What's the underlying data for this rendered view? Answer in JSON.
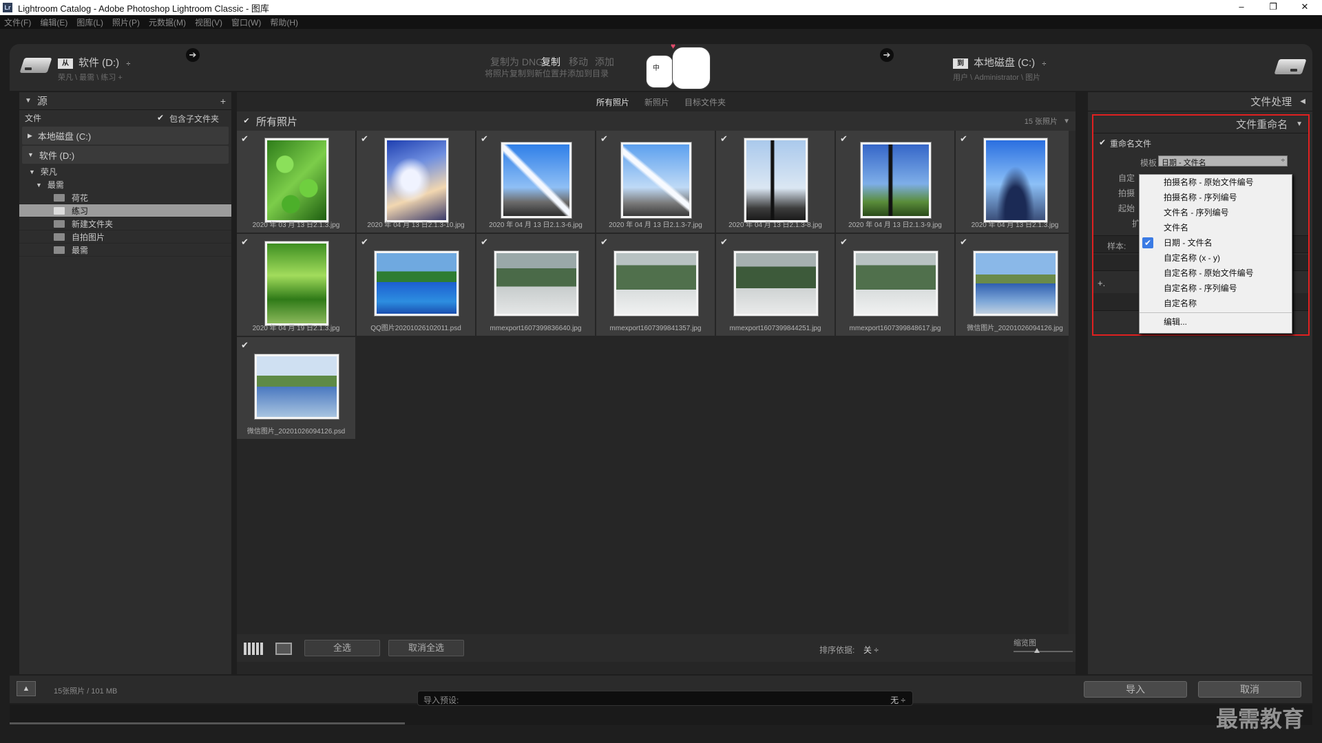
{
  "window": {
    "title": "Lightroom Catalog - Adobe Photoshop Lightroom Classic - 图库",
    "app_badge": "Lr",
    "min": "–",
    "max": "❐",
    "close": "✕"
  },
  "menu": [
    "文件(F)",
    "编辑(E)",
    "图库(L)",
    "照片(P)",
    "元数据(M)",
    "视图(V)",
    "窗口(W)",
    "帮助(H)"
  ],
  "source": {
    "drive_badge": "从",
    "drive": "软件 (D:)",
    "path": "荣凡 \\ 最需 \\ 练习 +"
  },
  "destination": {
    "drive_badge": "到",
    "drive": "本地磁盘 (C:)",
    "path": "用户 \\ Administrator \\ 图片"
  },
  "modes": [
    {
      "label": "复制为 DNG",
      "active": false
    },
    {
      "label": "复制",
      "active": true
    },
    {
      "label": "移动",
      "active": false
    },
    {
      "label": "添加",
      "active": false
    }
  ],
  "mode_description": "将照片复制到新位置并添加到目录",
  "ime_badge": "中",
  "left_panel": {
    "title": "源",
    "plus": "+",
    "files_label": "文件",
    "include_subfolders": "包含子文件夹",
    "drives": [
      "本地磁盘 (C:)",
      "软件 (D:)"
    ],
    "tree": [
      {
        "label": "荣凡",
        "level": 0
      },
      {
        "label": "最需",
        "level": 1
      }
    ],
    "folders": [
      "荷花",
      "练习",
      "新建文件夹",
      "自拍图片",
      "最需"
    ],
    "selected_folder": "练习"
  },
  "center": {
    "tabs": [
      "所有照片",
      "新照片",
      "目标文件夹"
    ],
    "active_tab": "所有照片",
    "header": "所有照片",
    "count": "15 张照片",
    "photos": [
      {
        "name": "2020 年 03 月 13 日2.1.3.jpg",
        "style": "i-leaf",
        "orient": "p"
      },
      {
        "name": "2020 年 04 月 13 日2.1.3-10.jpg",
        "style": "i-cloud",
        "orient": "p"
      },
      {
        "name": "2020 年 04 月 13 日2.1.3-6.jpg",
        "style": "i-trail",
        "orient": "s"
      },
      {
        "name": "2020 年 04 月 13 日2.1.3-7.jpg",
        "style": "i-trail2",
        "orient": "s"
      },
      {
        "name": "2020 年 04 月 13 日2.1.3-8.jpg",
        "style": "i-pole",
        "orient": "p"
      },
      {
        "name": "2020 年 04 月 13 日2.1.3-9.jpg",
        "style": "i-pole2",
        "orient": "s"
      },
      {
        "name": "2020 年 04 月 13 日2.1.3.jpg",
        "style": "i-tree",
        "orient": "p"
      },
      {
        "name": "2020 年 04 月 19 日2.1.3.jpg",
        "style": "i-vine",
        "orient": "p"
      },
      {
        "name": "QQ图片20201026102011.psd",
        "style": "i-lake",
        "orient": "l"
      },
      {
        "name": "mmexport1607399836640.jpg",
        "style": "i-snow",
        "orient": "l"
      },
      {
        "name": "mmexport1607399841357.jpg",
        "style": "i-snow2",
        "orient": "l"
      },
      {
        "name": "mmexport1607399844251.jpg",
        "style": "i-snow3",
        "orient": "l"
      },
      {
        "name": "mmexport1607399848617.jpg",
        "style": "i-snow2",
        "orient": "l"
      },
      {
        "name": "微信图片_20201026094126.jpg",
        "style": "i-lake2",
        "orient": "l"
      },
      {
        "name": "微信图片_20201026094126.psd",
        "style": "i-lake3",
        "orient": "l"
      }
    ],
    "toolbar": {
      "select_all": "全选",
      "deselect_all": "取消全选",
      "sort_label": "排序依据:",
      "sort_value": "关 ÷",
      "thumb_label": "缩览图"
    }
  },
  "right_panel": {
    "header": "文件处理",
    "section": "文件重命名",
    "rename_label": "重命名文件",
    "template_label": "模板",
    "template_value": "日期 - 文件名",
    "partial_labels": [
      "自定",
      "拍摄",
      "起始",
      "扩"
    ],
    "sample_label": "样本:",
    "plus": "+.",
    "options": [
      "拍摄名称 - 原始文件编号",
      "拍摄名称 - 序列编号",
      "文件名 - 序列编号",
      "文件名",
      "日期 - 文件名",
      "自定名称 (x - y)",
      "自定名称 - 原始文件编号",
      "自定名称 - 序列编号",
      "自定名称"
    ],
    "selected_option": "日期 - 文件名",
    "edit_option": "编辑..."
  },
  "bottom": {
    "status": "15张照片 / 101 MB",
    "preset_label": "导入预设:",
    "preset_value": "无 ÷",
    "import": "导入",
    "cancel": "取消"
  },
  "watermark": "最需教育"
}
